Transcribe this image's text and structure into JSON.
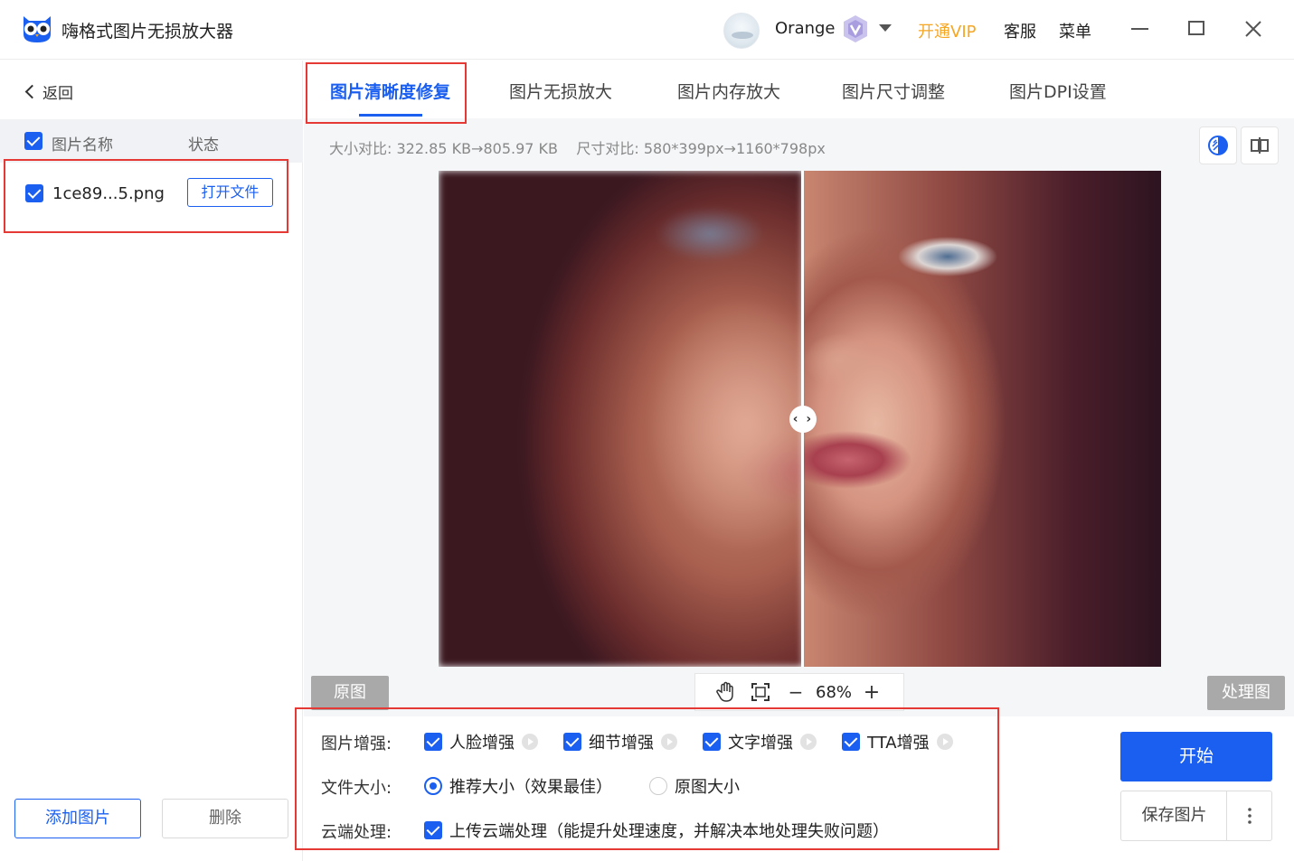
{
  "app": {
    "title": "嗨格式图片无损放大器"
  },
  "header": {
    "username": "Orange",
    "vip_label": "开通VIP",
    "service_label": "客服",
    "menu_label": "菜单"
  },
  "sidebar": {
    "back_label": "返回",
    "col_name": "图片名称",
    "col_status": "状态",
    "files": [
      {
        "name": "1ce89...5.png",
        "action": "打开文件"
      }
    ],
    "add_label": "添加图片",
    "delete_label": "删除"
  },
  "tabs": [
    {
      "label": "图片清晰度修复",
      "active": true
    },
    {
      "label": "图片无损放大"
    },
    {
      "label": "图片内存放大"
    },
    {
      "label": "图片尺寸调整"
    },
    {
      "label": "图片DPI设置"
    }
  ],
  "info": {
    "size_compare_label": "大小对比:",
    "size_from": "322.85 KB",
    "size_to": "805.97 KB",
    "dim_compare_label": "尺寸对比:",
    "dim_from": "580*399px",
    "dim_to": "1160*798px",
    "arrow": "→"
  },
  "preview": {
    "original_label": "原图",
    "processed_label": "处理图",
    "zoom": "68%",
    "zoom_minus": "−",
    "zoom_plus": "+"
  },
  "settings": {
    "enhance_label": "图片增强:",
    "enhance_options": [
      {
        "label": "人脸增强",
        "checked": true
      },
      {
        "label": "细节增强",
        "checked": true
      },
      {
        "label": "文字增强",
        "checked": true
      },
      {
        "label": "TTA增强",
        "checked": true
      }
    ],
    "filesize_label": "文件大小:",
    "filesize_options": [
      {
        "label": "推荐大小（效果最佳）",
        "selected": true
      },
      {
        "label": "原图大小",
        "selected": false
      }
    ],
    "cloud_label": "云端处理:",
    "cloud_option": {
      "label": "上传云端处理（能提升处理速度，并解决本地处理失败问题）",
      "checked": true
    }
  },
  "actions": {
    "start_label": "开始",
    "save_label": "保存图片"
  },
  "colors": {
    "accent": "#1a5ff0",
    "vip": "#f5a623",
    "highlight_box": "#e53935"
  }
}
